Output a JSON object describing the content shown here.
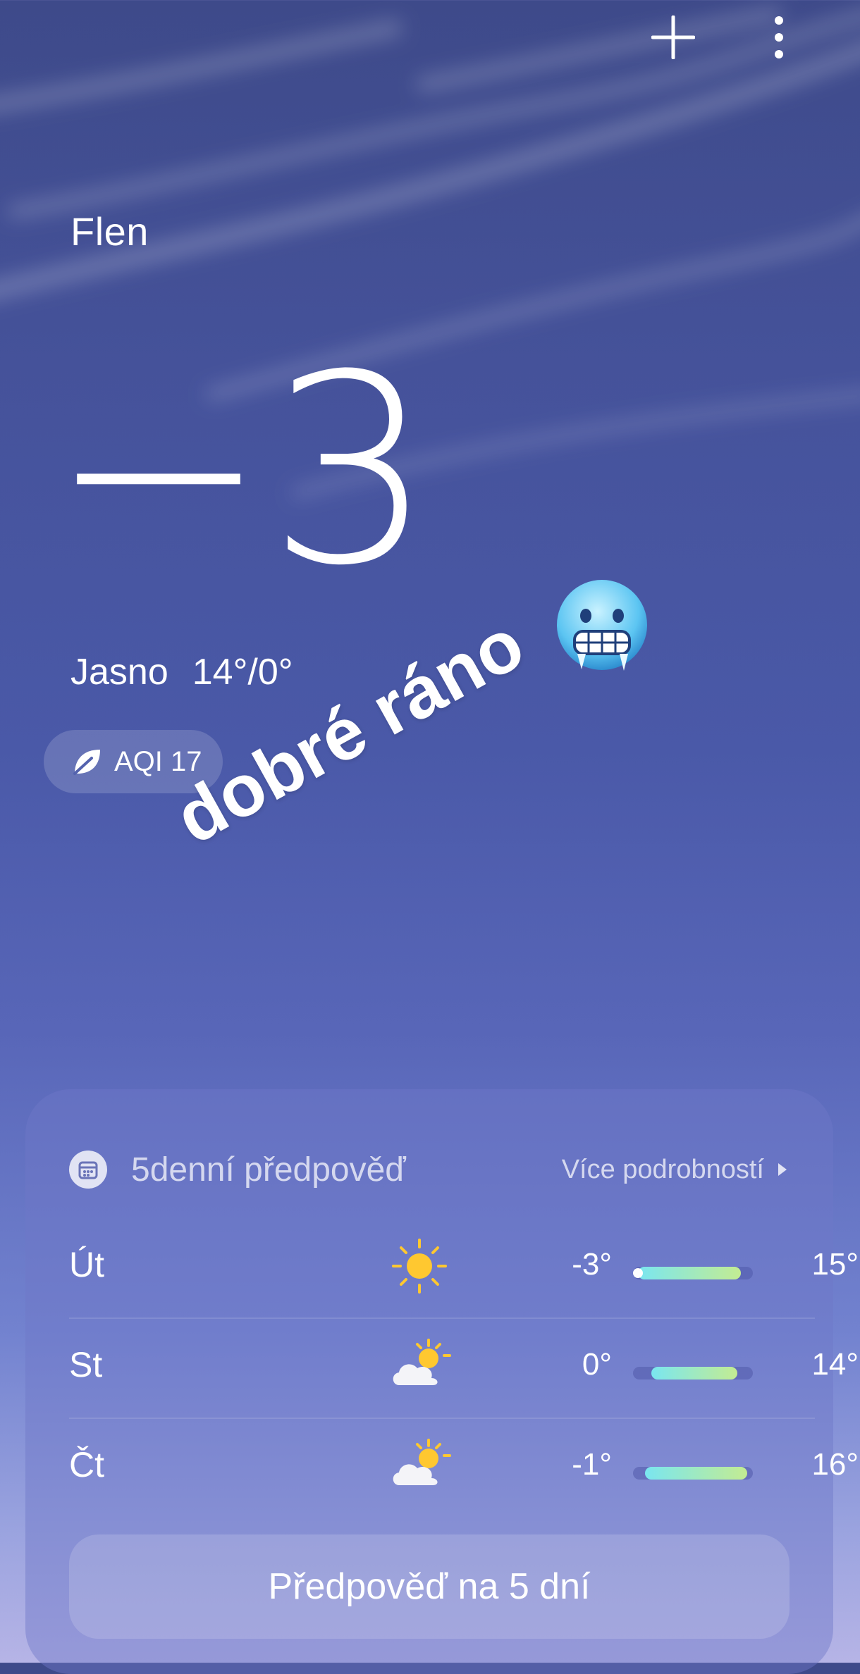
{
  "location": {
    "city": "Flen"
  },
  "current": {
    "temperature": "−3°",
    "condition": "Jasno",
    "high_low": "14°/0°",
    "aqi_label": "AQI 17"
  },
  "overlay": {
    "text": "dobré ráno",
    "emoji": "cold-face-emoji"
  },
  "toolbar": {
    "add_icon": "plus-icon",
    "menu_icon": "more-vertical-icon"
  },
  "forecast_card": {
    "title": "5denní předpověď",
    "more_link": "Více podrobností",
    "days": [
      {
        "name": "Út",
        "icon": "sun-icon",
        "low": "-3°",
        "high": "15°",
        "range_start": 0.04,
        "range_end": 0.9,
        "current_marker": 0.04
      },
      {
        "name": "St",
        "icon": "partly-cloudy-icon",
        "low": "0°",
        "high": "14°",
        "range_start": 0.15,
        "range_end": 0.87
      },
      {
        "name": "Čt",
        "icon": "partly-cloudy-icon",
        "low": "-1°",
        "high": "16°",
        "range_start": 0.1,
        "range_end": 0.95
      }
    ],
    "button_label": "Předpověď na 5 dní"
  },
  "colors": {
    "bar_start": "#7ae6f0",
    "bar_end": "#c3ec92",
    "sun": "#ffc830"
  }
}
